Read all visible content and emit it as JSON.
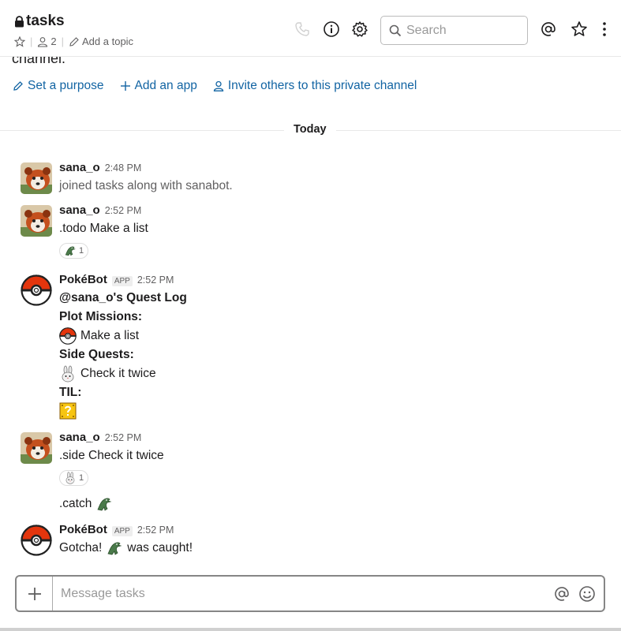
{
  "header": {
    "channel_name": "tasks",
    "member_count": "2",
    "add_topic": "Add a topic",
    "search_placeholder": "Search"
  },
  "intro": {
    "tail_text": "channel.",
    "actions": [
      "Set a purpose",
      "Add an app",
      "Invite others to this private channel"
    ]
  },
  "divider": {
    "label": "Today"
  },
  "messages": [
    {
      "author": "sana_o",
      "time": "2:48 PM",
      "text": "joined tasks along with sanabot."
    },
    {
      "author": "sana_o",
      "time": "2:52 PM",
      "text": ".todo Make a list",
      "reaction_count": "1"
    },
    {
      "author": "PokéBot",
      "badge": "APP",
      "time": "2:52 PM",
      "lines": [
        "@sana_o's Quest Log",
        "Plot Missions:",
        "Make a list",
        "Side Quests:",
        "Check it twice",
        "TIL:"
      ]
    },
    {
      "author": "sana_o",
      "time": "2:52 PM",
      "text": ".side Check it twice",
      "reaction_count": "1",
      "followup": ".catch"
    },
    {
      "author": "PokéBot",
      "badge": "APP",
      "time": "2:52 PM",
      "text_before": "Gotcha!",
      "text_after": "was caught!"
    }
  ],
  "composer": {
    "placeholder": "Message tasks"
  },
  "colors": {
    "link": "#1264a3",
    "muted": "#616061",
    "pokeball_red": "#e3350d"
  }
}
